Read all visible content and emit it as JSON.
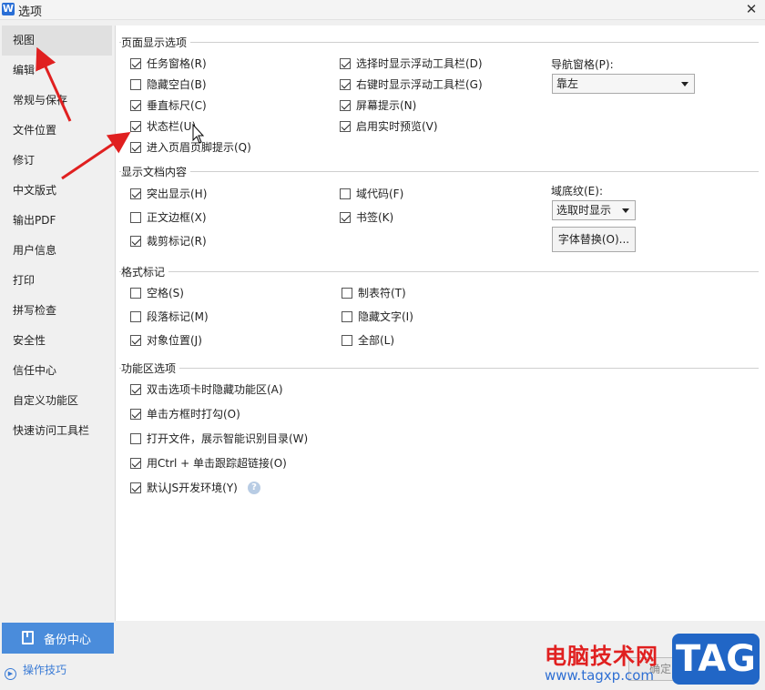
{
  "window": {
    "title": "选项",
    "app_icon": "wps-writer-icon"
  },
  "sidebar": {
    "items": [
      {
        "label": "视图",
        "active": true
      },
      {
        "label": "编辑"
      },
      {
        "label": "常规与保存"
      },
      {
        "label": "文件位置"
      },
      {
        "label": "修订"
      },
      {
        "label": "中文版式"
      },
      {
        "label": "输出PDF"
      },
      {
        "label": "用户信息"
      },
      {
        "label": "打印"
      },
      {
        "label": "拼写检查"
      },
      {
        "label": "安全性"
      },
      {
        "label": "信任中心"
      },
      {
        "label": "自定义功能区"
      },
      {
        "label": "快速访问工具栏"
      }
    ],
    "backup_label": "备份中心",
    "tips_label": "操作技巧"
  },
  "page_display": {
    "title": "页面显示选项",
    "col1": [
      {
        "label": "任务窗格(R)",
        "checked": true
      },
      {
        "label": "隐藏空白(B)",
        "checked": false
      },
      {
        "label": "垂直标尺(C)",
        "checked": true
      },
      {
        "label": "状态栏(U)",
        "checked": true
      },
      {
        "label": "进入页眉页脚提示(Q)",
        "checked": true
      }
    ],
    "col2": [
      {
        "label": "选择时显示浮动工具栏(D)",
        "checked": true
      },
      {
        "label": "右键时显示浮动工具栏(G)",
        "checked": true
      },
      {
        "label": "屏幕提示(N)",
        "checked": true
      },
      {
        "label": "启用实时预览(V)",
        "checked": true
      }
    ],
    "nav_pane_label": "导航窗格(P):",
    "nav_pane_value": "靠左"
  },
  "doc_content": {
    "title": "显示文档内容",
    "col1": [
      {
        "label": "突出显示(H)",
        "checked": true
      },
      {
        "label": "正文边框(X)",
        "checked": false
      },
      {
        "label": "裁剪标记(R)",
        "checked": true
      }
    ],
    "col2": [
      {
        "label": "域代码(F)",
        "checked": false
      },
      {
        "label": "书签(K)",
        "checked": true
      }
    ],
    "field_shading_label": "域底纹(E):",
    "field_shading_value": "选取时显示",
    "font_replace_label": "字体替换(O)..."
  },
  "format_marks": {
    "title": "格式标记",
    "col1": [
      {
        "label": "空格(S)",
        "checked": false
      },
      {
        "label": "段落标记(M)",
        "checked": false
      },
      {
        "label": "对象位置(J)",
        "checked": true
      }
    ],
    "col2": [
      {
        "label": "制表符(T)",
        "checked": false
      },
      {
        "label": "隐藏文字(I)",
        "checked": false
      },
      {
        "label": "全部(L)",
        "checked": false
      }
    ]
  },
  "ribbon": {
    "title": "功能区选项",
    "items": [
      {
        "label": "双击选项卡时隐藏功能区(A)",
        "checked": true
      },
      {
        "label": "单击方框时打勾(O)",
        "checked": true
      },
      {
        "label": "打开文件，展示智能识别目录(W)",
        "checked": false
      },
      {
        "label": "用Ctrl + 单击跟踪超链接(O)",
        "checked": true
      },
      {
        "label": "默认JS开发环境(Y)",
        "checked": true
      }
    ],
    "help_glyph": "?"
  },
  "footer": {
    "ok_label": "确定"
  },
  "watermark": {
    "site_name": "电脑技术网",
    "url": "www.tagxp.com",
    "tag": "TAG"
  },
  "colors": {
    "accent": "#4a8cdb",
    "annotation_arrow": "#e02020",
    "watermark_red": "#e02020",
    "watermark_blue": "#2166c6"
  }
}
